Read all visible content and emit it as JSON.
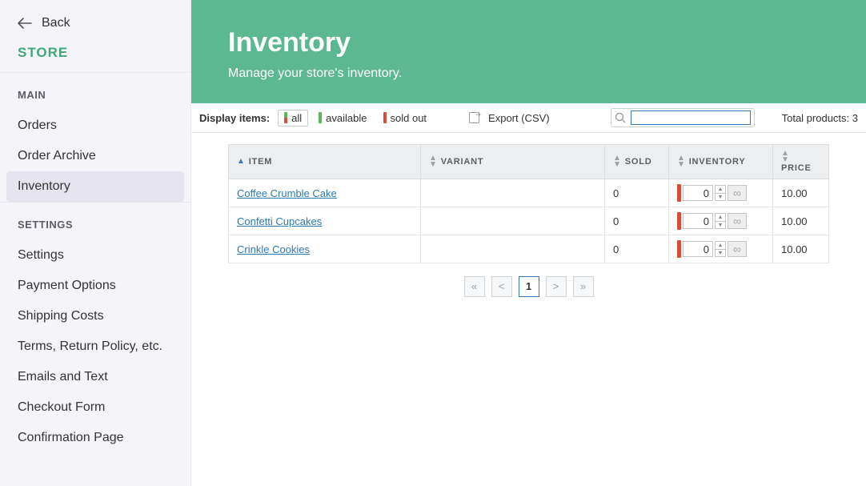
{
  "back_label": "Back",
  "store_label": "STORE",
  "main_label": "MAIN",
  "settings_label": "SETTINGS",
  "nav_main": [
    {
      "label": "Orders"
    },
    {
      "label": "Order Archive"
    },
    {
      "label": "Inventory",
      "active": true
    }
  ],
  "nav_settings": [
    {
      "label": "Settings"
    },
    {
      "label": "Payment Options"
    },
    {
      "label": "Shipping Costs"
    },
    {
      "label": "Terms, Return Policy, etc."
    },
    {
      "label": "Emails and Text"
    },
    {
      "label": "Checkout Form"
    },
    {
      "label": "Confirmation Page"
    }
  ],
  "hero": {
    "title": "Inventory",
    "subtitle": "Manage your store's inventory."
  },
  "toolbar": {
    "display_label": "Display items:",
    "filters": {
      "all": "all",
      "available": "available",
      "soldout": "sold out"
    },
    "export_label": "Export (CSV)",
    "total_label": "Total products: 3"
  },
  "columns": {
    "item": "ITEM",
    "variant": "VARIANT",
    "sold": "SOLD",
    "inventory": "INVENTORY",
    "price": "PRICE"
  },
  "rows": [
    {
      "item": "Coffee Crumble Cake",
      "variant": "",
      "sold": "0",
      "inv": "0",
      "price": "10.00"
    },
    {
      "item": "Confetti Cupcakes",
      "variant": "",
      "sold": "0",
      "inv": "0",
      "price": "10.00"
    },
    {
      "item": "Crinkle Cookies",
      "variant": "",
      "sold": "0",
      "inv": "0",
      "price": "10.00"
    }
  ],
  "pager": {
    "first": "«",
    "prev": "<",
    "current": "1",
    "next": ">",
    "last": "»"
  }
}
